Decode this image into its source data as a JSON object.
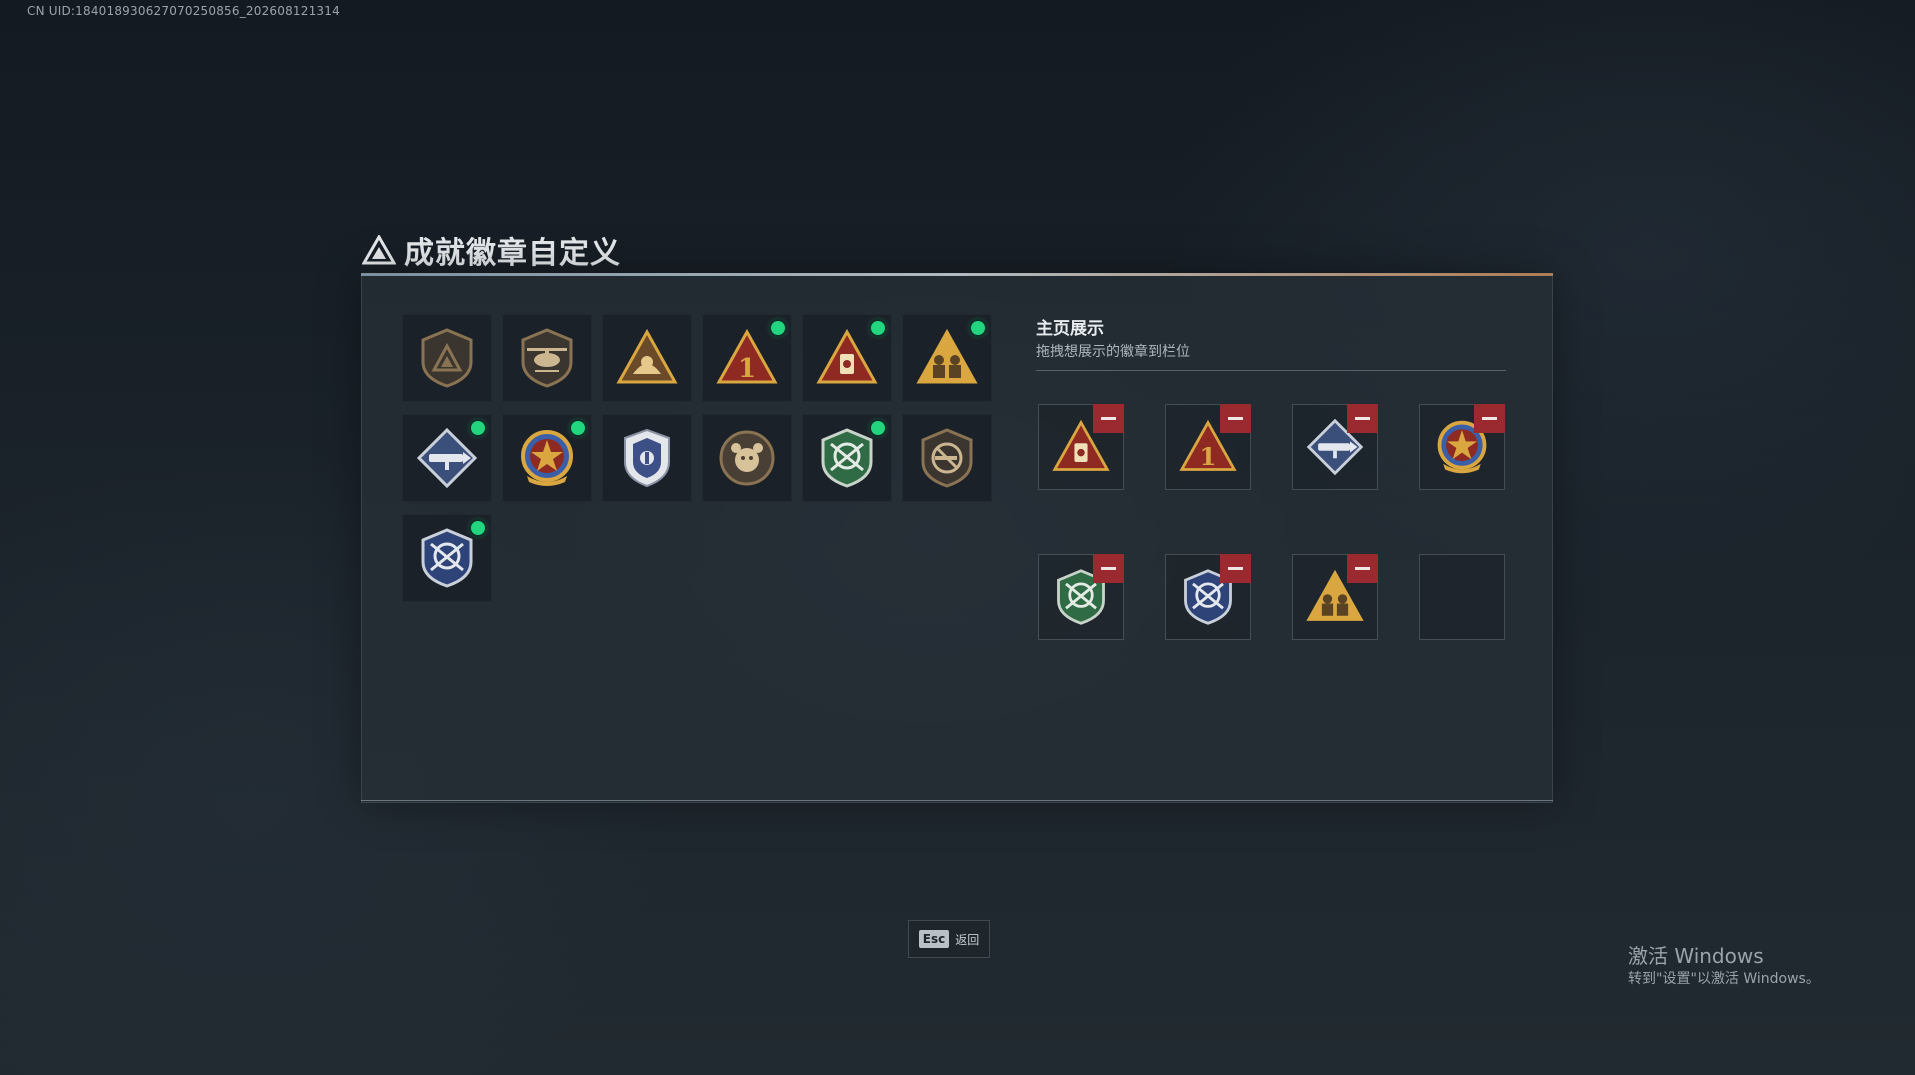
{
  "watermark": {
    "uid": "CN UID:18401893062707025085​6_202608121314"
  },
  "header": {
    "title": "成就徽章自定义"
  },
  "collection": {
    "badges": [
      {
        "icon": "shield-triangle-badge-icon",
        "new": false
      },
      {
        "icon": "helicopter-badge-icon",
        "new": false
      },
      {
        "icon": "hands-triangle-badge-icon",
        "new": false
      },
      {
        "icon": "number-one-triangle-badge-icon",
        "new": true
      },
      {
        "icon": "lantern-triangle-badge-icon",
        "new": true
      },
      {
        "icon": "soldiers-triangle-badge-icon",
        "new": true
      },
      {
        "icon": "rocket-launcher-diamond-badge-icon",
        "new": true
      },
      {
        "icon": "star-emblem-badge-icon",
        "new": true
      },
      {
        "icon": "police-shield-badge-icon",
        "new": false
      },
      {
        "icon": "bear-round-badge-icon",
        "new": false
      },
      {
        "icon": "rifles-green-shield-badge-icon",
        "new": true
      },
      {
        "icon": "no-gun-shield-badge-icon",
        "new": false
      },
      {
        "icon": "rifles-blue-shield-badge-icon",
        "new": true
      }
    ]
  },
  "showcase": {
    "title": "主页展示",
    "subtitle": "拖拽想展示的徽章到栏位",
    "slots": [
      {
        "icon": "lantern-triangle-badge-icon",
        "filled": true
      },
      {
        "icon": "number-one-triangle-badge-icon",
        "filled": true
      },
      {
        "icon": "rocket-launcher-diamond-badge-icon",
        "filled": true
      },
      {
        "icon": "star-emblem-badge-icon",
        "filled": true
      },
      {
        "icon": "rifles-green-shield-badge-icon",
        "filled": true
      },
      {
        "icon": "rifles-blue-shield-badge-icon",
        "filled": true
      },
      {
        "icon": "soldiers-triangle-badge-icon",
        "filled": true
      },
      {
        "icon": "",
        "filled": false
      }
    ]
  },
  "footer": {
    "esc_key": "Esc",
    "esc_label": "返回"
  },
  "windows_activation": {
    "title": "激活 Windows",
    "subtitle": "转到\"设置\"以激活 Windows。"
  },
  "colors": {
    "new_indicator": "#21d67e",
    "remove_button": "#9a2a2f",
    "badge_gold": "#d9a640",
    "badge_red": "#8e2a22"
  }
}
